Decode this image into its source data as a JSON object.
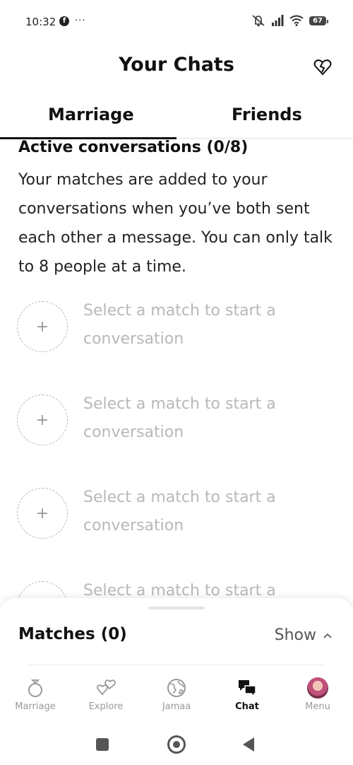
{
  "status_bar": {
    "time": "10:32",
    "more": "···",
    "battery": "67"
  },
  "header": {
    "title": "Your Chats"
  },
  "tabs": [
    {
      "label": "Marriage",
      "active": true
    },
    {
      "label": "Friends",
      "active": false
    }
  ],
  "active_section": {
    "title": "Active conversations (0/8)",
    "description": "Your matches are added to your conversations when you’ve both sent each other a message. You can only talk to 8 people at a time."
  },
  "slots": [
    {
      "text": "Select a match to start a conversation"
    },
    {
      "text": "Select a match to start a conversation"
    },
    {
      "text": "Select a match to start a conversation"
    },
    {
      "text": "Select a match to start a conversation"
    }
  ],
  "matches_sheet": {
    "title": "Matches (0)",
    "toggle_label": "Show"
  },
  "bottom_nav": [
    {
      "label": "Marriage",
      "icon": "ring-icon",
      "active": false
    },
    {
      "label": "Explore",
      "icon": "explore-hearts-icon",
      "active": false
    },
    {
      "label": "Jamaa",
      "icon": "globe-icon",
      "active": false
    },
    {
      "label": "Chat",
      "icon": "chat-bubbles-icon",
      "active": true
    },
    {
      "label": "Menu",
      "icon": "avatar",
      "active": false
    }
  ],
  "colors": {
    "text_primary": "#111111",
    "placeholder": "#b8b8b8",
    "nav_inactive": "#9a9a9a"
  }
}
